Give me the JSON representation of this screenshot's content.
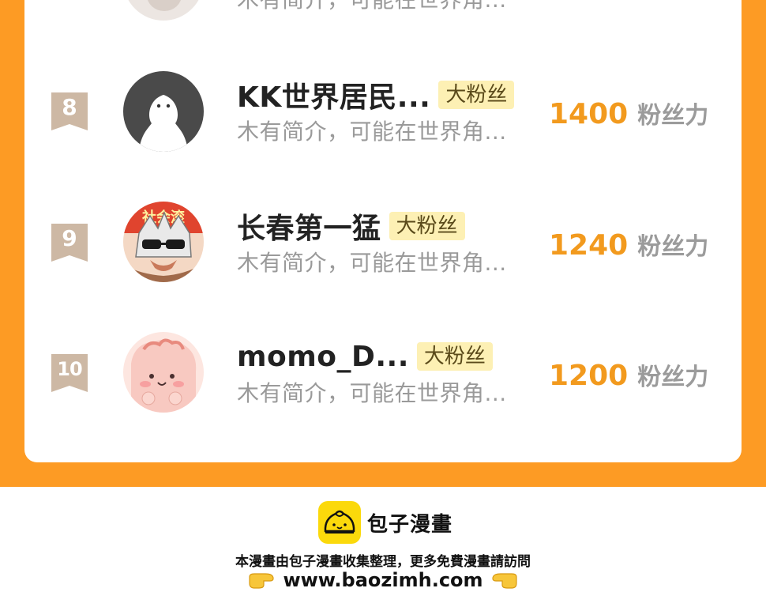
{
  "ranking": {
    "rows": [
      {
        "rank": "8",
        "name": "KK世界居民...",
        "tag": "大粉丝",
        "bio": "木有简介，可能在世界角...",
        "power": "1400",
        "power_unit": "粉丝力",
        "avatar": "white-ghost-avatar"
      },
      {
        "rank": "9",
        "name": "长春第一猛",
        "tag": "大粉丝",
        "bio": "木有简介，可能在世界角...",
        "power": "1240",
        "power_unit": "粉丝力",
        "avatar": "sunglasses-cartoon-avatar",
        "avatar_text": "社会滚"
      },
      {
        "rank": "10",
        "name": "momo_D...",
        "tag": "大粉丝",
        "bio": "木有简介，可能在世界角...",
        "power": "1200",
        "power_unit": "粉丝力",
        "avatar": "pink-blob-avatar"
      }
    ],
    "partial_top_row": {
      "bio": "木有简介，可能在世界角..."
    }
  },
  "footer": {
    "brand_name": "包子漫畫",
    "slogan": "本漫畫由包子漫畫收集整理，更多免費漫畫請訪問",
    "url": "www.baozimh.com"
  },
  "colors": {
    "frame": "#fd9b24",
    "power": "#f29a1e",
    "tag_bg": "#fdf0b4",
    "badge": "#cdb8a4"
  }
}
